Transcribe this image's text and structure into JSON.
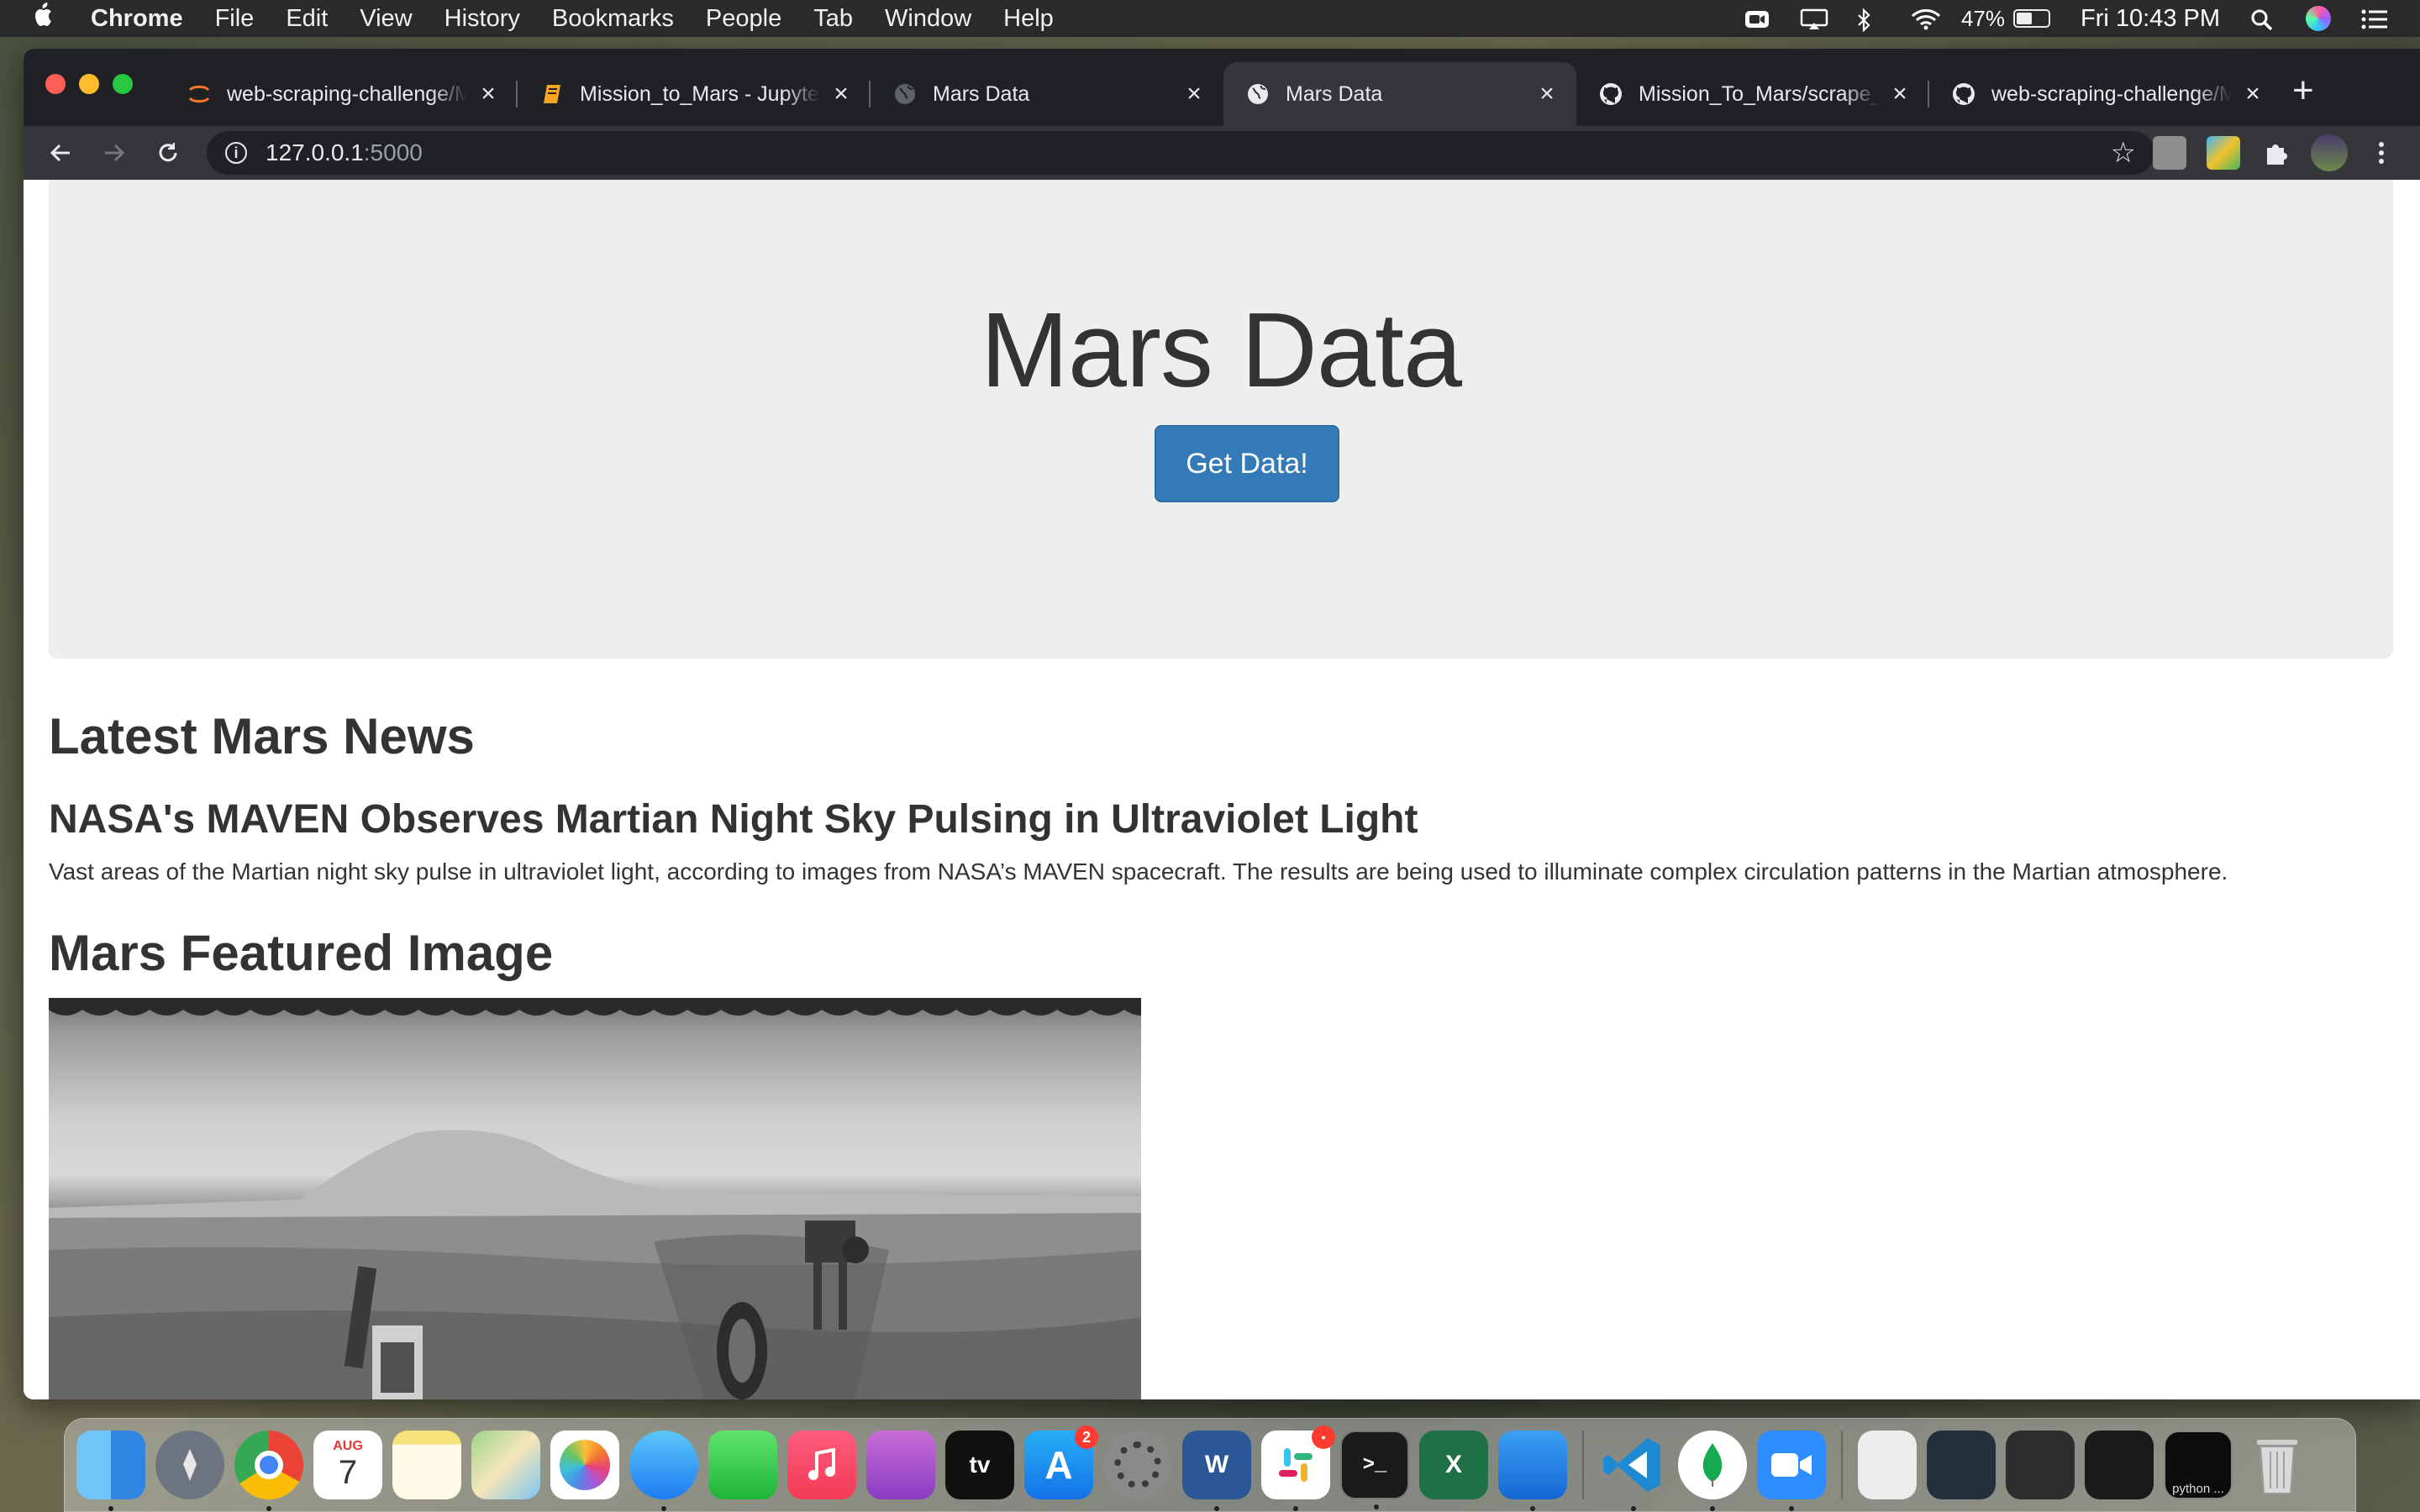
{
  "menubar": {
    "app": "Chrome",
    "items": [
      "File",
      "Edit",
      "View",
      "History",
      "Bookmarks",
      "People",
      "Tab",
      "Window",
      "Help"
    ],
    "battery_percent": "47%",
    "clock": "Fri 10:43 PM"
  },
  "browser": {
    "tabs": [
      {
        "title": "web-scraping-challenge/Missions",
        "icon": "jupyter-icon"
      },
      {
        "title": "Mission_to_Mars - Jupyter Notebook",
        "icon": "notebook-icon"
      },
      {
        "title": "Mars Data",
        "icon": "globe-icon"
      },
      {
        "title": "Mars Data",
        "icon": "globe-icon"
      },
      {
        "title": "Mission_To_Mars/scrape_mars.py",
        "icon": "github-icon"
      },
      {
        "title": "web-scraping-challenge/Missions",
        "icon": "github-icon"
      }
    ],
    "active_tab": 3,
    "url_host": "127.0.0.1",
    "url_port": ":5000"
  },
  "page": {
    "jumbotron_title": "Mars Data",
    "get_data_button": "Get Data!",
    "news_heading": "Latest Mars News",
    "news_title": "NASA's MAVEN Observes Martian Night Sky Pulsing in Ultraviolet Light",
    "news_paragraph": "Vast areas of the Martian night sky pulse in ultraviolet light, according to images from NASA’s MAVEN spacecraft. The results are being used to illuminate complex circulation patterns in the Martian atmosphere.",
    "featured_heading": "Mars Featured Image"
  },
  "dock": {
    "calendar_month": "AUG",
    "calendar_day": "7",
    "appstore_badge": "2",
    "tv_label": "tv",
    "word_label": "W",
    "excel_label": "X",
    "terminal_label": ">_",
    "python_label": "python ..."
  }
}
